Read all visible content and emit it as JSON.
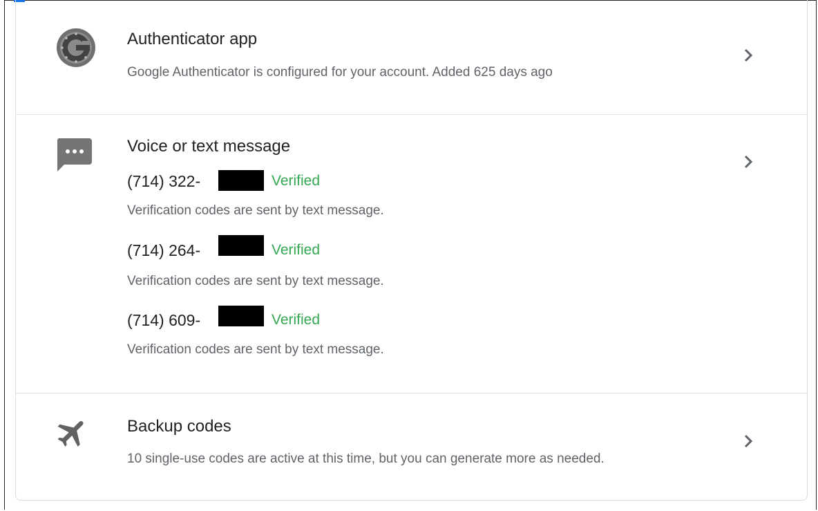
{
  "sections": {
    "authenticator": {
      "title": "Authenticator app",
      "description": "Google Authenticator is configured for your account. Added 625 days ago",
      "icon": "google-authenticator-icon"
    },
    "voice_text": {
      "title": "Voice or text message",
      "icon": "message-bubble-icon",
      "phones": [
        {
          "number": "(714) 322-",
          "status": "Verified",
          "note": "Verification codes are sent by text message."
        },
        {
          "number": "(714) 264-",
          "status": "Verified",
          "note": "Verification codes are sent by text message."
        },
        {
          "number": "(714) 609-",
          "status": "Verified",
          "note": "Verification codes are sent by text message."
        }
      ]
    },
    "backup": {
      "title": "Backup codes",
      "description": "10 single-use codes are active at this time, but you can generate more as needed.",
      "icon": "airplane-icon"
    }
  },
  "colors": {
    "verified": "#34a853",
    "title": "#202124",
    "description": "#5f6368",
    "icon_gray": "#757575",
    "accent": "#1a73e8"
  }
}
